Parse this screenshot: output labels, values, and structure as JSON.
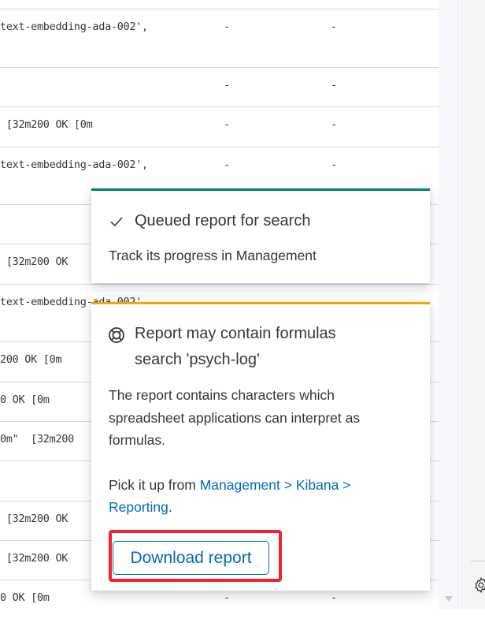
{
  "table": {
    "rows": [
      {
        "col1": "",
        "col2": "",
        "col3": ""
      },
      {
        "col1": "text-embedding-ada-002',",
        "col2": "-",
        "col3": "-"
      },
      {
        "col1": "",
        "col2": "-",
        "col3": "-"
      },
      {
        "col1": " [32m200 OK [0m",
        "col2": "-",
        "col3": "-"
      },
      {
        "col1": "text-embedding-ada-002',",
        "col2": "-",
        "col3": "-"
      },
      {
        "col1": "",
        "col2": "",
        "col3": ""
      },
      {
        "col1": " [32m200 OK",
        "col2": "",
        "col3": ""
      },
      {
        "col1": "text-embedding-ada-002',",
        "col2": "",
        "col3": ""
      },
      {
        "col1": "200 OK [0m",
        "col2": "",
        "col3": ""
      },
      {
        "col1": "0 OK [0m",
        "col2": "",
        "col3": ""
      },
      {
        "col1": "0m\"  [32m200",
        "col2": "",
        "col3": ""
      },
      {
        "col1": "",
        "col2": "",
        "col3": ""
      },
      {
        "col1": " [32m200 OK",
        "col2": "",
        "col3": ""
      },
      {
        "col1": " [32m200 OK",
        "col2": "",
        "col3": ""
      },
      {
        "col1": "0 OK [0m",
        "col2": "-",
        "col3": "-"
      }
    ]
  },
  "toasts": {
    "success": {
      "icon": "check-icon",
      "title": "Queued report for search",
      "body": "Track its progress in Management",
      "accent": "#017d73"
    },
    "warning": {
      "icon": "help-lifering-icon",
      "title_line1": "Report may contain formulas",
      "title_line2": "search 'psych-log'",
      "body_line1": "The report contains characters which",
      "body_line2": "spreadsheet applications can interpret as",
      "body_line3": "formulas.",
      "pickup_prefix": "Pick it up from ",
      "pickup_link_line1": "Management > Kibana >",
      "pickup_link_line2": "Reporting",
      "pickup_suffix": ".",
      "button_label": "Download report",
      "accent": "#f5a700"
    }
  },
  "right_panel": {
    "icon": "gear-icon"
  }
}
